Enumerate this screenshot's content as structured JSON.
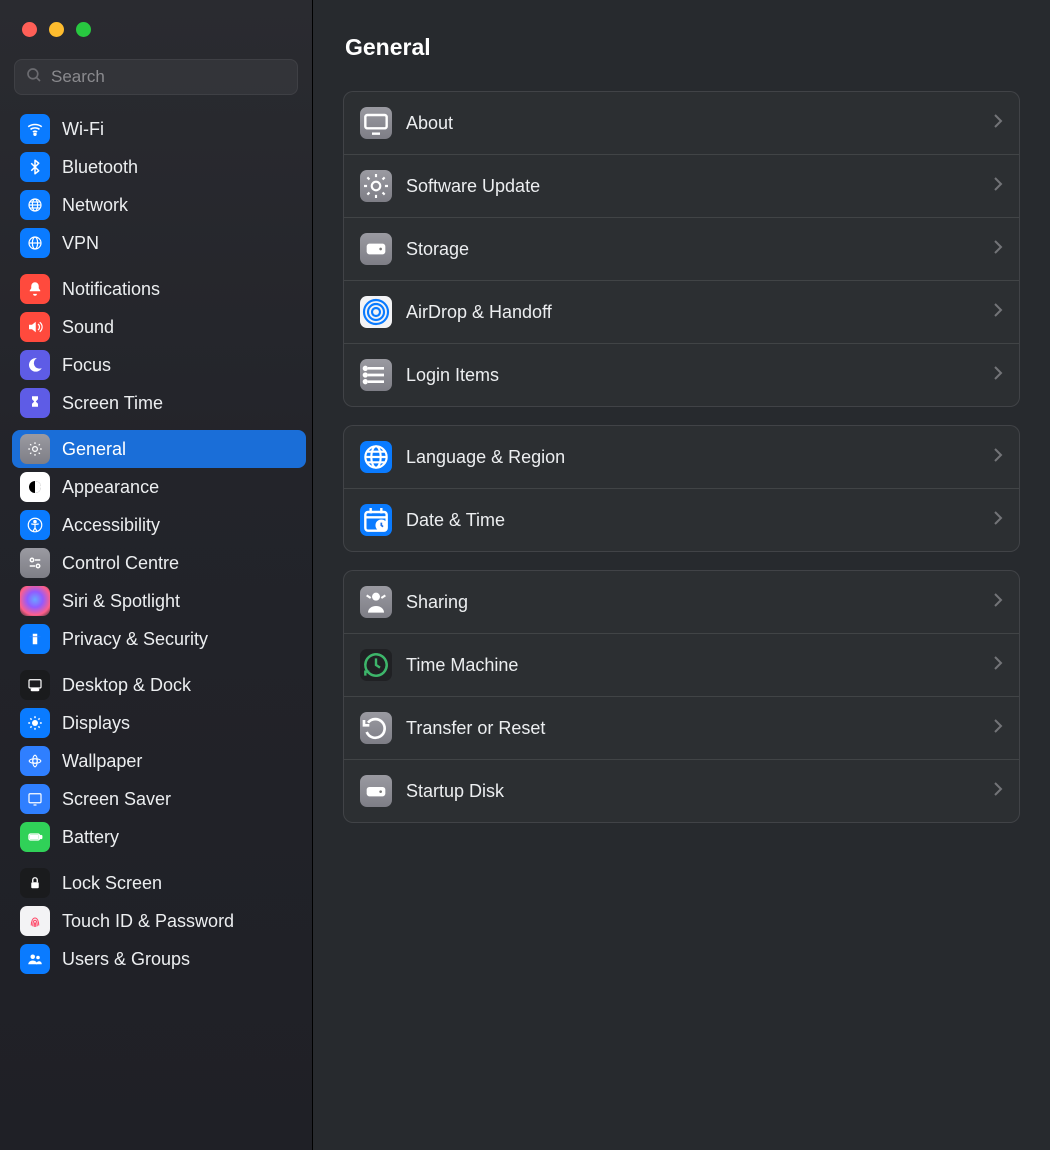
{
  "header": {
    "title": "General"
  },
  "search": {
    "placeholder": "Search"
  },
  "sidebar": {
    "groups": [
      [
        {
          "label": "Wi-Fi"
        },
        {
          "label": "Bluetooth"
        },
        {
          "label": "Network"
        },
        {
          "label": "VPN"
        }
      ],
      [
        {
          "label": "Notifications"
        },
        {
          "label": "Sound"
        },
        {
          "label": "Focus"
        },
        {
          "label": "Screen Time"
        }
      ],
      [
        {
          "label": "General",
          "selected": true
        },
        {
          "label": "Appearance"
        },
        {
          "label": "Accessibility"
        },
        {
          "label": "Control Centre"
        },
        {
          "label": "Siri & Spotlight"
        },
        {
          "label": "Privacy & Security"
        }
      ],
      [
        {
          "label": "Desktop & Dock"
        },
        {
          "label": "Displays"
        },
        {
          "label": "Wallpaper"
        },
        {
          "label": "Screen Saver"
        },
        {
          "label": "Battery"
        }
      ],
      [
        {
          "label": "Lock Screen"
        },
        {
          "label": "Touch ID & Password"
        },
        {
          "label": "Users & Groups"
        }
      ]
    ]
  },
  "main": {
    "panels": [
      [
        {
          "label": "About"
        },
        {
          "label": "Software Update"
        },
        {
          "label": "Storage"
        },
        {
          "label": "AirDrop & Handoff"
        },
        {
          "label": "Login Items"
        }
      ],
      [
        {
          "label": "Language & Region"
        },
        {
          "label": "Date & Time"
        }
      ],
      [
        {
          "label": "Sharing"
        },
        {
          "label": "Time Machine"
        },
        {
          "label": "Transfer or Reset"
        },
        {
          "label": "Startup Disk"
        }
      ]
    ]
  }
}
